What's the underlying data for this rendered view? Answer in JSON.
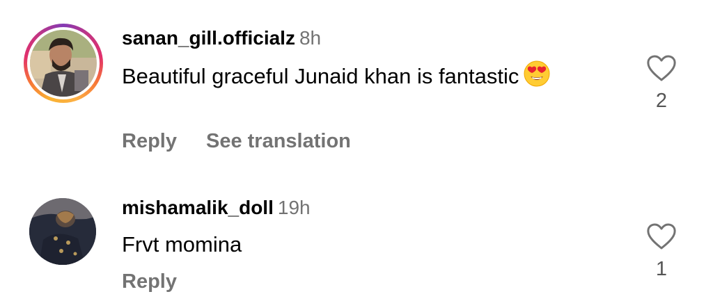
{
  "comments": [
    {
      "username": "sanan_gill.officialz",
      "time": "8h",
      "text": "Beautiful graceful Junaid khan is fantastic",
      "emoji": "heart-eyes-emoji",
      "reply_label": "Reply",
      "translate_label": "See translation",
      "like_count": "2",
      "has_story_ring": true
    },
    {
      "username": "mishamalik_doll",
      "time": "19h",
      "text": "Frvt momina",
      "reply_label": "Reply",
      "like_count": "1",
      "has_story_ring": false
    }
  ],
  "colors": {
    "secondary_text": "#737373",
    "story_ring_start": "#f9b233",
    "story_ring_end": "#c13584"
  }
}
